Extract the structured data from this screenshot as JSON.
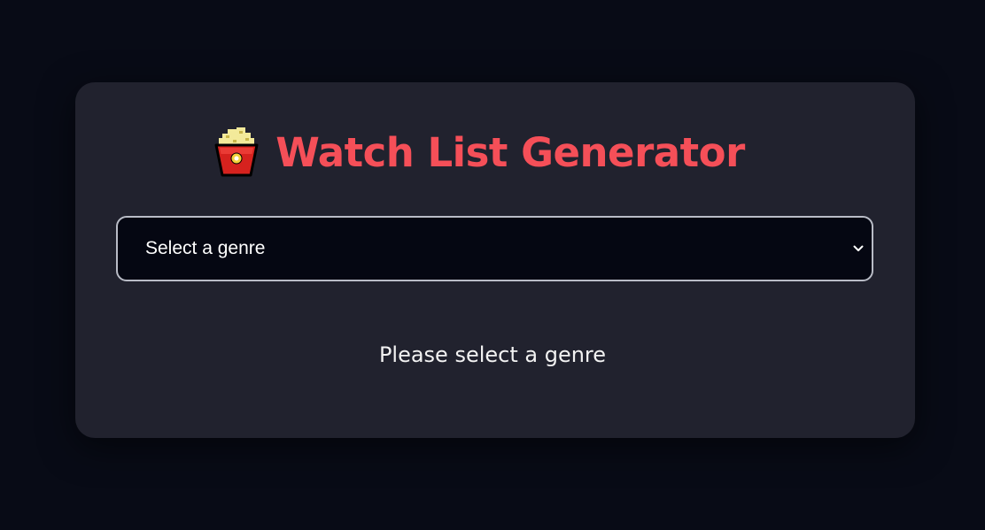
{
  "app": {
    "title": "Watch List Generator",
    "title_icon": "popcorn-icon"
  },
  "genre_select": {
    "selected_label": "Select a genre",
    "icon": "chevron-down-icon"
  },
  "status": {
    "message": "Please select a genre"
  },
  "colors": {
    "page_background": "#080b16",
    "card_background": "#21222e",
    "accent": "#f54f58",
    "select_background": "#050712",
    "select_border": "#b9bcc6",
    "text": "#f2f2f2"
  }
}
